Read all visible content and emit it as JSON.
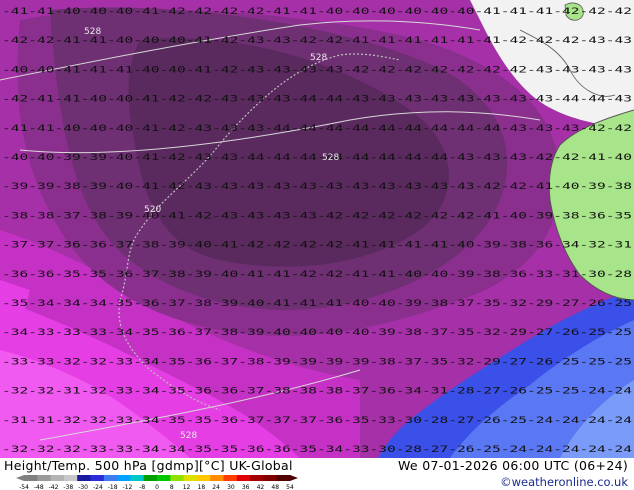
{
  "header": {
    "title": "Height/Temp. 500 hPa [gdmp][°C] UK-Global",
    "datetime": "We 07-01-2026 06:00 UTC (06+24)",
    "credit": "©weatheronline.co.uk"
  },
  "legend": {
    "ticks": [
      "-54",
      "-48",
      "-42",
      "-38",
      "-30",
      "-24",
      "-18",
      "-12",
      "-8",
      "0",
      "8",
      "12",
      "18",
      "24",
      "30",
      "36",
      "42",
      "48",
      "54"
    ],
    "colors": [
      "#808080",
      "#9a9a9a",
      "#b4b4b4",
      "#c8c8c8",
      "#1a1aa0",
      "#2b2bd8",
      "#3d7cf0",
      "#00a0ff",
      "#00c8c8",
      "#00a000",
      "#00c800",
      "#90e000",
      "#e0e000",
      "#ffc800",
      "#ff8c00",
      "#ff3c00",
      "#e00000",
      "#a00000",
      "#800000",
      "#500000"
    ]
  },
  "map": {
    "colors": {
      "land": "#a8e48a",
      "ocean_light": "#f2f2f2",
      "coast": "#555555",
      "contour": "#d8d8d8",
      "t_minus_44": "#5a2a5e",
      "t_minus_42": "#6e2f73",
      "t_minus_40": "#8a2f8e",
      "t_minus_38": "#a630a8",
      "t_minus_36": "#c431c4",
      "t_minus_34": "#e43ee4",
      "t_minus_32": "#f15af0",
      "t_minus_30": "#3a50e8",
      "t_minus_26": "#5a78f4",
      "t_minus_24": "#7a9cf8"
    },
    "contour_labels": [
      "528",
      "528",
      "520",
      "528",
      "528"
    ],
    "temp_labels": {
      "rows": [
        {
          "text": "-41-41-40-40-40-41-42-42-42-42-41-41-40-40-40-40-40-40-41-41-41-42-42-42"
        },
        {
          "text": "-42-42-41-41-40-40-40-41-42-43-43-42-42-41-41-41-41-41-41-42-42-42-43-43"
        },
        {
          "text": "-40-40-41-41-41-40-40-41-42-43-43-43-43-42-42-42-42-42-42-42-43-43-43-43"
        },
        {
          "text": "-42-41-41-40-40-41-42-42-43-43-43-44-44-43-43-43-43-43-43-43-43-44-44-43"
        },
        {
          "text": "-41-41-40-40-40-41-42-43-43-43-44-44-44-44-44-44-44-44-44-43-43-43-42-42"
        },
        {
          "text": "-40-40-39-39-40-41-42-43-43-44-44-44-44-44-44-44-44-43-43-43-42-42-41-40"
        },
        {
          "text": "-39-39-38-39-40-41-42-43-43-43-43-43-43-43-43-43-43-43-42-42-41-40-39-38"
        },
        {
          "text": "-38-38-37-38-39-40-41-42-43-43-43-43-42-42-42-42-42-42-41-40-39-38-36-35"
        },
        {
          "text": "-37-37-36-36-37-38-39-40-41-42-42-42-42-41-41-41-41-40-39-38-36-34-32-31"
        },
        {
          "text": "-36-36-35-35-36-37-38-39-40-41-41-42-42-41-41-40-40-39-38-36-33-31-30-28"
        },
        {
          "text": "-35-34-34-34-35-36-37-38-39-40-41-41-41-40-40-39-38-37-35-32-29-27-26-25"
        },
        {
          "text": "-34-33-33-33-34-35-36-37-38-39-40-40-40-40-39-38-37-35-32-29-27-26-25-25"
        },
        {
          "text": "-33-33-32-32-33-34-35-36-37-38-39-39-39-39-38-37-35-32-29-27-26-25-25-25"
        },
        {
          "text": "-32-32-31-32-33-34-35-36-36-37-38-38-38-37-36-34-31-28-27-26-25-25-24-24"
        },
        {
          "text": "-31-31-32-32-33-34-35-35-36-37-37-37-36-35-33-30-28-27-26-25-24-24-24-24"
        },
        {
          "text": "-32-32-32-33-33-34-34-35-35-36-36-35-34-33-30-28-27-26-25-24-24-24-24-24"
        }
      ]
    }
  }
}
